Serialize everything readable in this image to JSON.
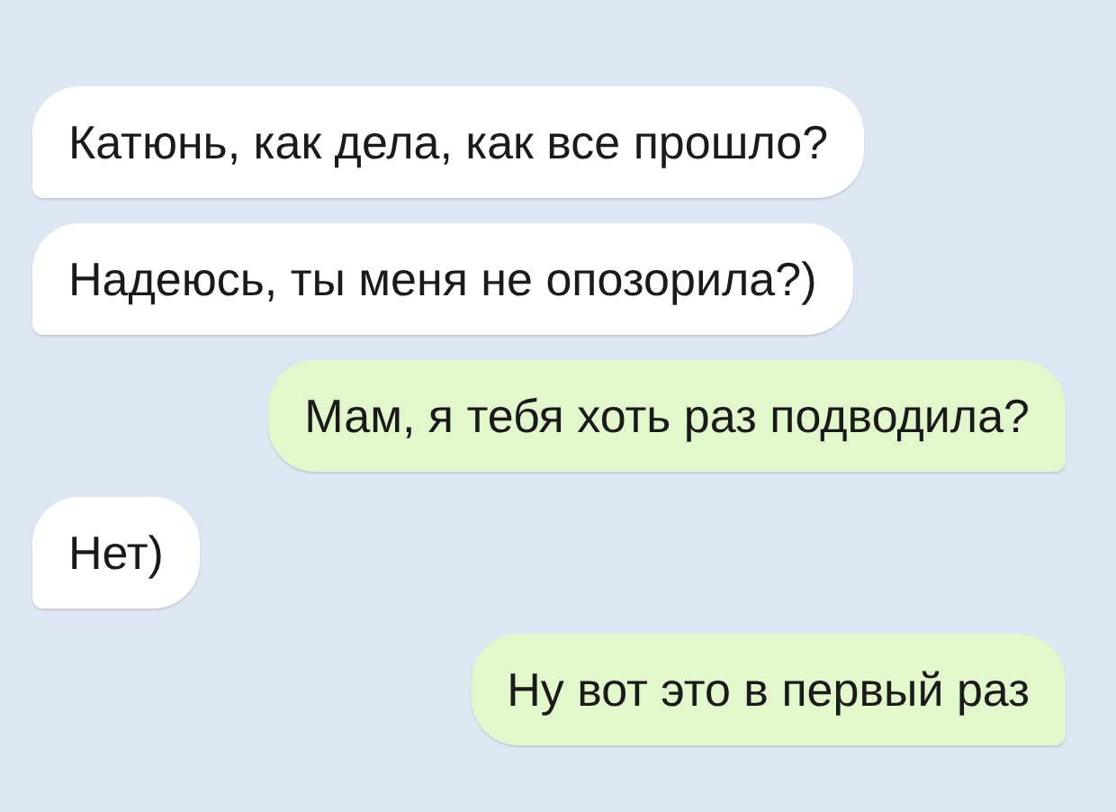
{
  "messages": [
    {
      "kind": "incoming",
      "text": "Катюнь, как дела, как все прошло?"
    },
    {
      "kind": "incoming",
      "text": "Надеюсь, ты меня не опозорила?)"
    },
    {
      "kind": "outgoing",
      "text": "Мам, я тебя хоть раз подводила?"
    },
    {
      "kind": "incoming",
      "text": "Нет)"
    },
    {
      "kind": "outgoing",
      "text": "Ну вот это в первый раз"
    }
  ]
}
